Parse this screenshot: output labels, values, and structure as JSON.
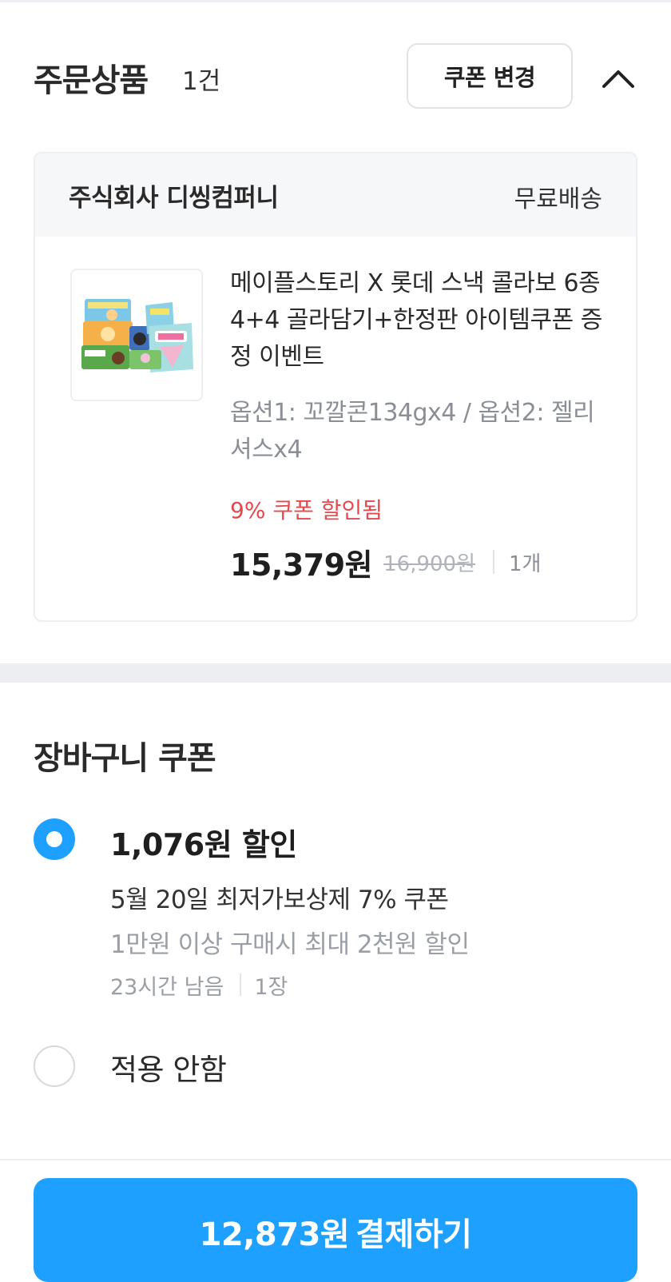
{
  "order": {
    "title": "주문상품",
    "count": "1건",
    "coupon_change_label": "쿠폰 변경"
  },
  "seller": {
    "name": "주식회사 디씽컴퍼니",
    "shipping": "무료배송"
  },
  "product": {
    "name": "메이플스토리 X 롯데 스낵 콜라보 6종 4+4 골라담기+한정판 아이템쿠폰 증정 이벤트",
    "option": "옵션1: 꼬깔콘134gx4 / 옵션2: 젤리셔스x4",
    "coupon_applied": "9% 쿠폰 할인됨",
    "sale_price": "15,379원",
    "original_price": "16,900원",
    "quantity": "1개"
  },
  "cart_coupon": {
    "title": "장바구니 쿠폰",
    "options": [
      {
        "discount": "1,076원 할인",
        "name": "5월 20일 최저가보상제 7% 쿠폰",
        "condition": "1만원 이상 구매시 최대 2천원 할인",
        "time_left": "23시간 남음",
        "count": "1장",
        "selected": true
      },
      {
        "label": "적용 안함",
        "selected": false
      }
    ]
  },
  "payment": {
    "amount": "12,873원",
    "action": "결제하기"
  },
  "colors": {
    "accent": "#1da0ff",
    "discount_red": "#e5484d",
    "muted": "#9a9ea5"
  }
}
